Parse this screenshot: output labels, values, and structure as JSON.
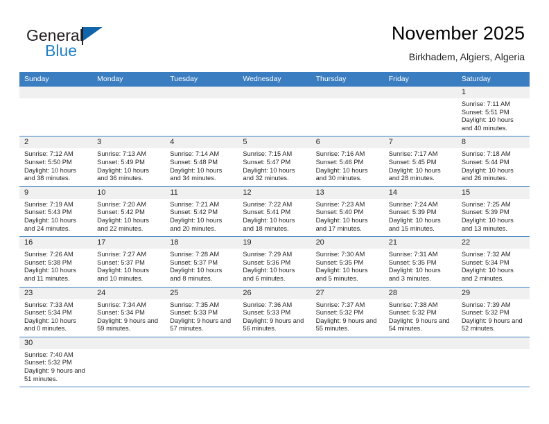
{
  "brand": {
    "line1": "General",
    "line2": "Blue",
    "flag_color": "#1166ab",
    "blue_color": "#1f7fc4"
  },
  "header": {
    "title": "November 2025",
    "subtitle": "Birkhadem, Algiers, Algeria"
  },
  "theme": {
    "header_blue": "#3a7dc0",
    "daynum_bg": "#f0f0f0",
    "text": "#231f20"
  },
  "weekdays": [
    "Sunday",
    "Monday",
    "Tuesday",
    "Wednesday",
    "Thursday",
    "Friday",
    "Saturday"
  ],
  "labels": {
    "sunrise_prefix": "Sunrise: ",
    "sunset_prefix": "Sunset: ",
    "daylight_prefix": "Daylight: "
  },
  "weeks": [
    [
      {
        "empty": true
      },
      {
        "empty": true
      },
      {
        "empty": true
      },
      {
        "empty": true
      },
      {
        "empty": true
      },
      {
        "empty": true
      },
      {
        "day": "1",
        "sunrise": "Sunrise: 7:11 AM",
        "sunset": "Sunset: 5:51 PM",
        "daylight": "Daylight: 10 hours and 40 minutes."
      }
    ],
    [
      {
        "day": "2",
        "sunrise": "Sunrise: 7:12 AM",
        "sunset": "Sunset: 5:50 PM",
        "daylight": "Daylight: 10 hours and 38 minutes."
      },
      {
        "day": "3",
        "sunrise": "Sunrise: 7:13 AM",
        "sunset": "Sunset: 5:49 PM",
        "daylight": "Daylight: 10 hours and 36 minutes."
      },
      {
        "day": "4",
        "sunrise": "Sunrise: 7:14 AM",
        "sunset": "Sunset: 5:48 PM",
        "daylight": "Daylight: 10 hours and 34 minutes."
      },
      {
        "day": "5",
        "sunrise": "Sunrise: 7:15 AM",
        "sunset": "Sunset: 5:47 PM",
        "daylight": "Daylight: 10 hours and 32 minutes."
      },
      {
        "day": "6",
        "sunrise": "Sunrise: 7:16 AM",
        "sunset": "Sunset: 5:46 PM",
        "daylight": "Daylight: 10 hours and 30 minutes."
      },
      {
        "day": "7",
        "sunrise": "Sunrise: 7:17 AM",
        "sunset": "Sunset: 5:45 PM",
        "daylight": "Daylight: 10 hours and 28 minutes."
      },
      {
        "day": "8",
        "sunrise": "Sunrise: 7:18 AM",
        "sunset": "Sunset: 5:44 PM",
        "daylight": "Daylight: 10 hours and 26 minutes."
      }
    ],
    [
      {
        "day": "9",
        "sunrise": "Sunrise: 7:19 AM",
        "sunset": "Sunset: 5:43 PM",
        "daylight": "Daylight: 10 hours and 24 minutes."
      },
      {
        "day": "10",
        "sunrise": "Sunrise: 7:20 AM",
        "sunset": "Sunset: 5:42 PM",
        "daylight": "Daylight: 10 hours and 22 minutes."
      },
      {
        "day": "11",
        "sunrise": "Sunrise: 7:21 AM",
        "sunset": "Sunset: 5:42 PM",
        "daylight": "Daylight: 10 hours and 20 minutes."
      },
      {
        "day": "12",
        "sunrise": "Sunrise: 7:22 AM",
        "sunset": "Sunset: 5:41 PM",
        "daylight": "Daylight: 10 hours and 18 minutes."
      },
      {
        "day": "13",
        "sunrise": "Sunrise: 7:23 AM",
        "sunset": "Sunset: 5:40 PM",
        "daylight": "Daylight: 10 hours and 17 minutes."
      },
      {
        "day": "14",
        "sunrise": "Sunrise: 7:24 AM",
        "sunset": "Sunset: 5:39 PM",
        "daylight": "Daylight: 10 hours and 15 minutes."
      },
      {
        "day": "15",
        "sunrise": "Sunrise: 7:25 AM",
        "sunset": "Sunset: 5:39 PM",
        "daylight": "Daylight: 10 hours and 13 minutes."
      }
    ],
    [
      {
        "day": "16",
        "sunrise": "Sunrise: 7:26 AM",
        "sunset": "Sunset: 5:38 PM",
        "daylight": "Daylight: 10 hours and 11 minutes."
      },
      {
        "day": "17",
        "sunrise": "Sunrise: 7:27 AM",
        "sunset": "Sunset: 5:37 PM",
        "daylight": "Daylight: 10 hours and 10 minutes."
      },
      {
        "day": "18",
        "sunrise": "Sunrise: 7:28 AM",
        "sunset": "Sunset: 5:37 PM",
        "daylight": "Daylight: 10 hours and 8 minutes."
      },
      {
        "day": "19",
        "sunrise": "Sunrise: 7:29 AM",
        "sunset": "Sunset: 5:36 PM",
        "daylight": "Daylight: 10 hours and 6 minutes."
      },
      {
        "day": "20",
        "sunrise": "Sunrise: 7:30 AM",
        "sunset": "Sunset: 5:35 PM",
        "daylight": "Daylight: 10 hours and 5 minutes."
      },
      {
        "day": "21",
        "sunrise": "Sunrise: 7:31 AM",
        "sunset": "Sunset: 5:35 PM",
        "daylight": "Daylight: 10 hours and 3 minutes."
      },
      {
        "day": "22",
        "sunrise": "Sunrise: 7:32 AM",
        "sunset": "Sunset: 5:34 PM",
        "daylight": "Daylight: 10 hours and 2 minutes."
      }
    ],
    [
      {
        "day": "23",
        "sunrise": "Sunrise: 7:33 AM",
        "sunset": "Sunset: 5:34 PM",
        "daylight": "Daylight: 10 hours and 0 minutes."
      },
      {
        "day": "24",
        "sunrise": "Sunrise: 7:34 AM",
        "sunset": "Sunset: 5:34 PM",
        "daylight": "Daylight: 9 hours and 59 minutes."
      },
      {
        "day": "25",
        "sunrise": "Sunrise: 7:35 AM",
        "sunset": "Sunset: 5:33 PM",
        "daylight": "Daylight: 9 hours and 57 minutes."
      },
      {
        "day": "26",
        "sunrise": "Sunrise: 7:36 AM",
        "sunset": "Sunset: 5:33 PM",
        "daylight": "Daylight: 9 hours and 56 minutes."
      },
      {
        "day": "27",
        "sunrise": "Sunrise: 7:37 AM",
        "sunset": "Sunset: 5:32 PM",
        "daylight": "Daylight: 9 hours and 55 minutes."
      },
      {
        "day": "28",
        "sunrise": "Sunrise: 7:38 AM",
        "sunset": "Sunset: 5:32 PM",
        "daylight": "Daylight: 9 hours and 54 minutes."
      },
      {
        "day": "29",
        "sunrise": "Sunrise: 7:39 AM",
        "sunset": "Sunset: 5:32 PM",
        "daylight": "Daylight: 9 hours and 52 minutes."
      }
    ],
    [
      {
        "day": "30",
        "sunrise": "Sunrise: 7:40 AM",
        "sunset": "Sunset: 5:32 PM",
        "daylight": "Daylight: 9 hours and 51 minutes."
      },
      {
        "empty": true
      },
      {
        "empty": true
      },
      {
        "empty": true
      },
      {
        "empty": true
      },
      {
        "empty": true
      },
      {
        "empty": true
      }
    ]
  ]
}
